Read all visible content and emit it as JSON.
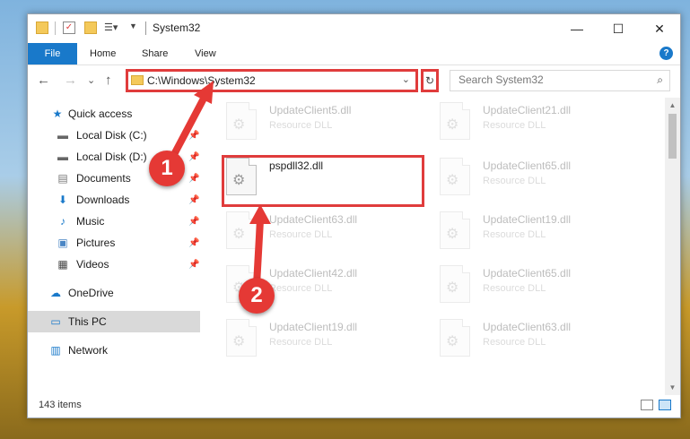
{
  "window": {
    "title": "System32",
    "controls": {
      "minimize": "—",
      "maximize": "☐",
      "close": "✕"
    }
  },
  "ribbon": {
    "tabs": [
      "File",
      "Home",
      "Share",
      "View"
    ],
    "help": "?"
  },
  "navigation": {
    "back": "←",
    "forward": "→",
    "recent": "⌄",
    "up": "↑",
    "address": "C:\\Windows\\System32",
    "refresh": "↻",
    "search_placeholder": "Search System32",
    "search_icon": "⌕"
  },
  "sidebar": {
    "items": [
      {
        "label": "Quick access",
        "icon": "star-icon"
      },
      {
        "label": "Local Disk (C:)",
        "icon": "drive-icon",
        "pinned": true
      },
      {
        "label": "Local Disk (D:)",
        "icon": "drive-icon",
        "pinned": true
      },
      {
        "label": "Documents",
        "icon": "document-icon",
        "pinned": true
      },
      {
        "label": "Downloads",
        "icon": "download-icon",
        "pinned": true
      },
      {
        "label": "Music",
        "icon": "music-icon",
        "pinned": true
      },
      {
        "label": "Pictures",
        "icon": "picture-icon",
        "pinned": true
      },
      {
        "label": "Videos",
        "icon": "video-icon",
        "pinned": true
      },
      {
        "label": "OneDrive",
        "icon": "cloud-icon"
      },
      {
        "label": "This PC",
        "icon": "computer-icon",
        "selected": true
      },
      {
        "label": "Network",
        "icon": "network-icon"
      }
    ]
  },
  "files": [
    {
      "name": "UpdateClient5.dll",
      "type": "Resource DLL",
      "faded": true
    },
    {
      "name": "UpdateClient21.dll",
      "type": "Resource DLL",
      "faded": true
    },
    {
      "name": "pspdll32.dll",
      "type": "",
      "faded": false
    },
    {
      "name": "UpdateClient65.dll",
      "type": "Resource DLL",
      "faded": true
    },
    {
      "name": "UpdateClient63.dll",
      "type": "Resource DLL",
      "faded": true
    },
    {
      "name": "UpdateClient19.dll",
      "type": "Resource DLL",
      "faded": true
    },
    {
      "name": "UpdateClient42.dll",
      "type": "Resource DLL",
      "faded": true
    },
    {
      "name": "UpdateClient65.dll",
      "type": "Resource DLL",
      "faded": true
    },
    {
      "name": "UpdateClient19.dll",
      "type": "Resource DLL",
      "faded": true
    },
    {
      "name": "UpdateClient63.dll",
      "type": "Resource DLL",
      "faded": true
    }
  ],
  "status": {
    "items": "143 items"
  },
  "annotations": {
    "badge1": "1",
    "badge2": "2"
  },
  "colors": {
    "accent": "#1979ca",
    "highlight": "#e03c3c",
    "badge": "#e53935"
  }
}
